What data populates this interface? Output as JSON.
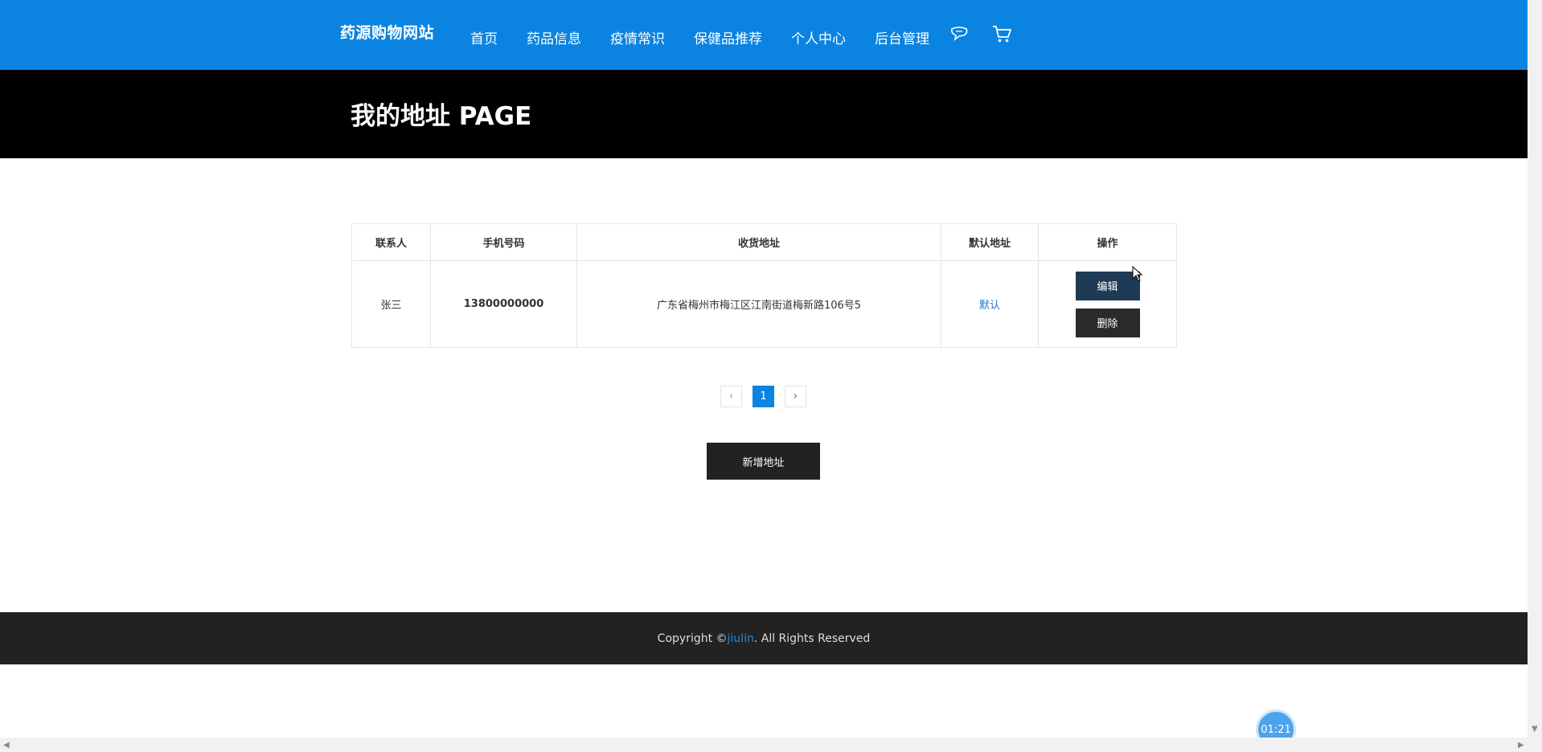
{
  "header": {
    "logo": "药源购物网站",
    "nav": [
      "首页",
      "药品信息",
      "疫情常识",
      "保健品推荐",
      "个人中心",
      "后台管理"
    ],
    "icons": [
      "chat-icon",
      "cart-icon"
    ],
    "bg_color": "#0a84e0"
  },
  "banner": {
    "title": "我的地址 PAGE"
  },
  "table": {
    "headers": [
      "联系人",
      "手机号码",
      "收货地址",
      "默认地址",
      "操作"
    ],
    "rows": [
      {
        "contact": "张三",
        "phone": "13800000000",
        "address": "广东省梅州市梅江区江南街道梅新路106号5",
        "default": "默认",
        "edit_label": "编辑",
        "delete_label": "删除"
      }
    ]
  },
  "pagination": {
    "prev": "‹",
    "current": "1",
    "next": "›"
  },
  "add_button": "新增地址",
  "footer": {
    "prefix": "Copyright © ",
    "brand": "jiulin",
    "suffix": ". All Rights Reserved"
  },
  "timer": "01:21"
}
